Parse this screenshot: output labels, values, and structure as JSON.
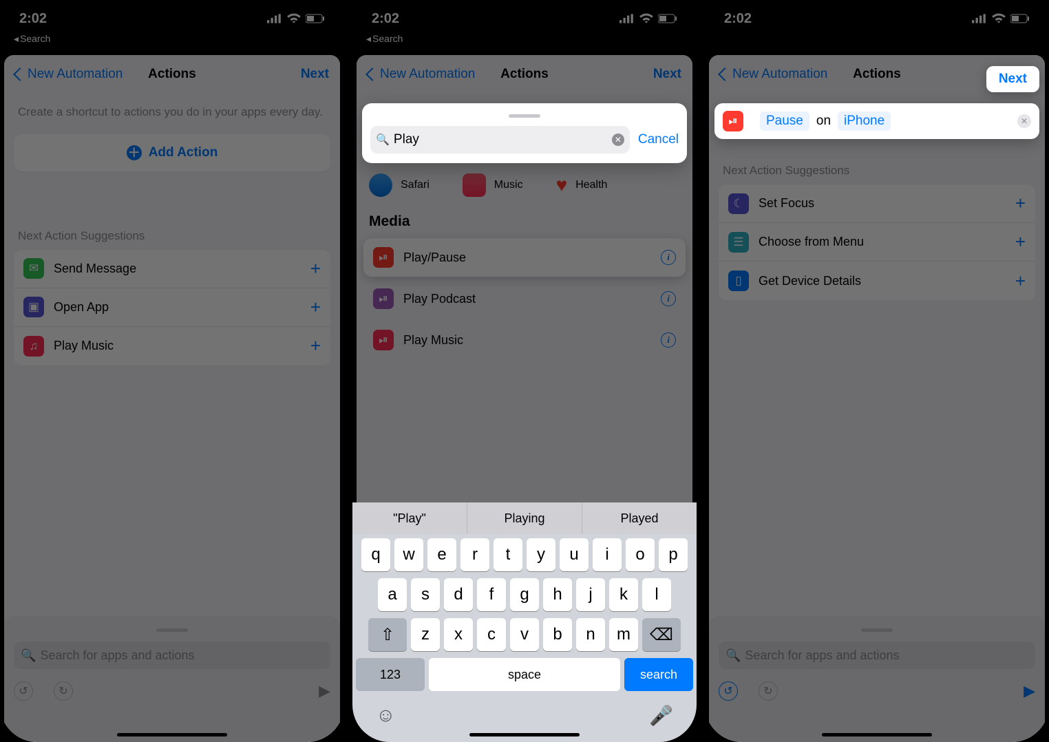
{
  "status": {
    "time": "2:02",
    "back": "Search"
  },
  "nav": {
    "back": "New Automation",
    "title": "Actions",
    "next": "Next"
  },
  "p1": {
    "desc": "Create a shortcut to actions you do in your apps every day.",
    "addAction": "Add Action",
    "suggestTitle": "Next Action Suggestions",
    "rows": [
      {
        "label": "Send Message",
        "color": "#34c759",
        "glyph": "✉︎"
      },
      {
        "label": "Open App",
        "color": "#5856d6",
        "glyph": "▣"
      },
      {
        "label": "Play Music",
        "color": "#ff2d55",
        "glyph": "♫"
      }
    ],
    "searchPlaceholder": "Search for apps and actions"
  },
  "p2": {
    "searchValue": "Play",
    "cancel": "Cancel",
    "apps": [
      {
        "label": "Safari",
        "color": "#1e90ff"
      },
      {
        "label": "Music",
        "color": "#ff2d55"
      },
      {
        "label": "Health",
        "color": "#ff3b30"
      }
    ],
    "mediaHeader": "Media",
    "results": [
      {
        "label": "Play/Pause",
        "color": "#ff3b30",
        "hi": true
      },
      {
        "label": "Play Podcast",
        "color": "#9b59b6",
        "hi": false
      },
      {
        "label": "Play Music",
        "color": "#ff2d55",
        "hi": false
      }
    ],
    "predict": [
      "\"Play\"",
      "Playing",
      "Played"
    ],
    "rowsK": [
      [
        "q",
        "w",
        "e",
        "r",
        "t",
        "y",
        "u",
        "i",
        "o",
        "p"
      ],
      [
        "a",
        "s",
        "d",
        "f",
        "g",
        "h",
        "j",
        "k",
        "l"
      ],
      [
        "⇧",
        "z",
        "x",
        "c",
        "v",
        "b",
        "n",
        "m",
        "⌫"
      ]
    ],
    "kb": {
      "n123": "123",
      "space": "space",
      "search": "search"
    }
  },
  "p3": {
    "action": {
      "verb": "Pause",
      "mid": "on",
      "target": "iPhone"
    },
    "suggestTitle": "Next Action Suggestions",
    "rows": [
      {
        "label": "Set Focus",
        "color": "#5856d6",
        "glyph": "☾"
      },
      {
        "label": "Choose from Menu",
        "color": "#2fb2c4",
        "glyph": "☰"
      },
      {
        "label": "Get Device Details",
        "color": "#007aff",
        "glyph": "▯"
      }
    ],
    "searchPlaceholder": "Search for apps and actions"
  }
}
